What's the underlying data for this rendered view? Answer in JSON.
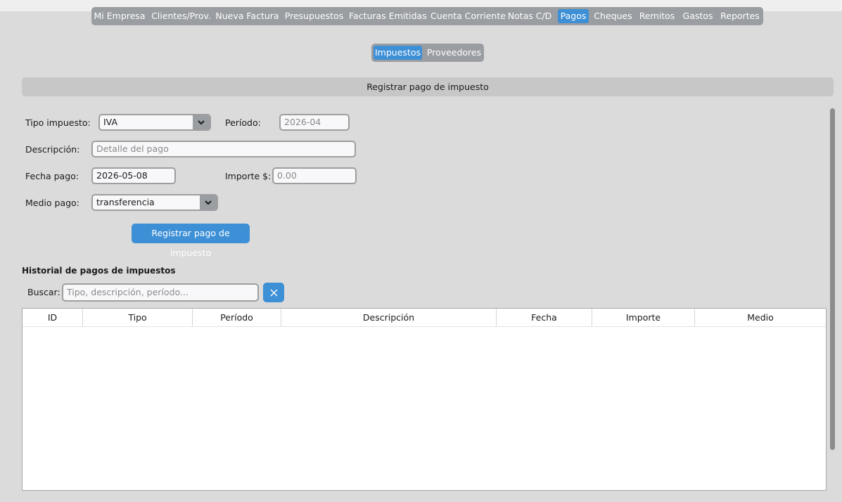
{
  "nav": {
    "items": [
      {
        "label": "Mi Empresa"
      },
      {
        "label": "Clientes/Prov."
      },
      {
        "label": "Nueva Factura"
      },
      {
        "label": "Presupuestos"
      },
      {
        "label": "Facturas Emitidas"
      },
      {
        "label": "Cuenta Corriente"
      },
      {
        "label": "Notas C/D"
      },
      {
        "label": "Pagos",
        "active": true
      },
      {
        "label": "Cheques"
      },
      {
        "label": "Remitos"
      },
      {
        "label": "Gastos"
      },
      {
        "label": "Reportes"
      }
    ]
  },
  "subnav": {
    "items": [
      {
        "label": "Impuestos",
        "active": true
      },
      {
        "label": "Proveedores"
      }
    ]
  },
  "section": {
    "title": "Registrar pago de impuesto"
  },
  "form": {
    "tipo_label": "Tipo impuesto:",
    "tipo_value": "IVA",
    "periodo_label": "Período:",
    "periodo_placeholder": "2026-04",
    "descripcion_label": "Descripción:",
    "descripcion_placeholder": "Detalle del pago",
    "fecha_label": "Fecha pago:",
    "fecha_value": "2026-05-08",
    "importe_label": "Importe $:",
    "importe_placeholder": "0.00",
    "medio_label": "Medio pago:",
    "medio_value": "transferencia",
    "submit_label": "Registrar pago de impuesto"
  },
  "history": {
    "title": "Historial de pagos de impuestos",
    "search_label": "Buscar:",
    "search_placeholder": "Tipo, descripción, período...",
    "columns": [
      "ID",
      "Tipo",
      "Período",
      "Descripción",
      "Fecha",
      "Importe",
      "Medio"
    ],
    "rows": []
  },
  "colors": {
    "accent": "#3d8fd6",
    "nav_bg": "#9a9da1",
    "page_bg": "#dbdbdb",
    "header_bg": "#c7c7c7"
  },
  "icons": {
    "dropdown": "chevron-down-icon",
    "clear": "close-icon"
  }
}
